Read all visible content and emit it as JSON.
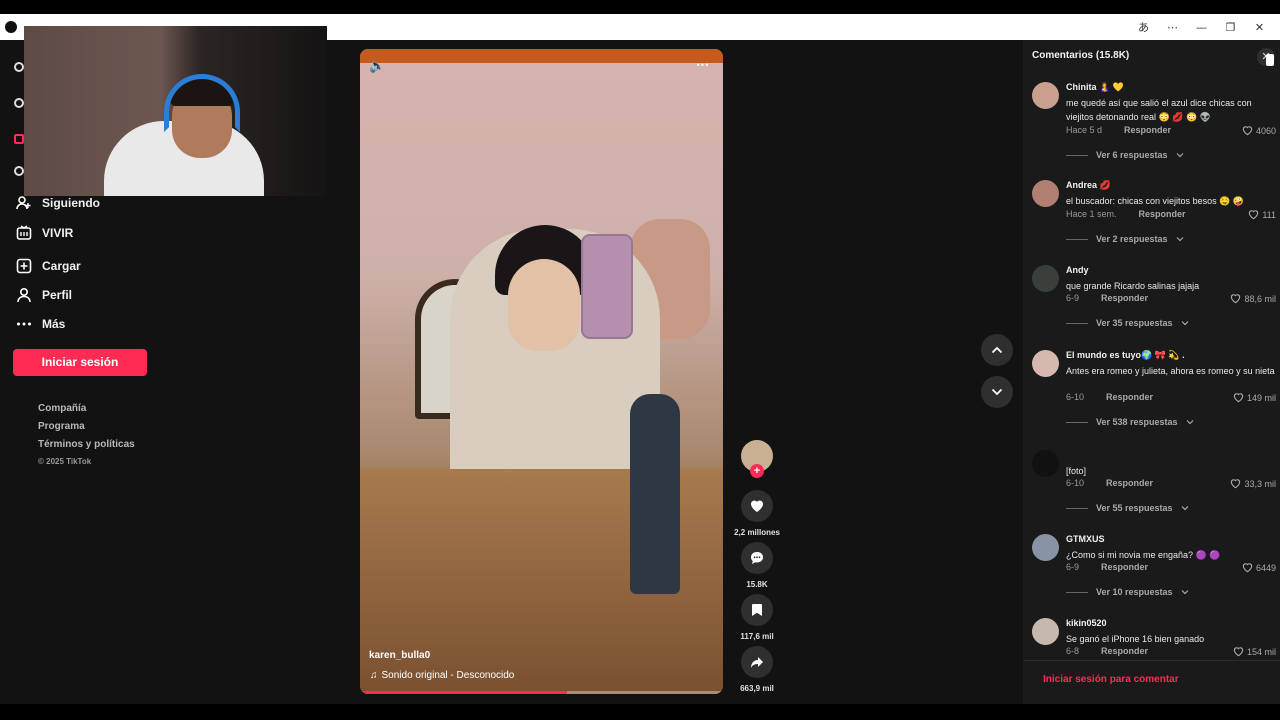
{
  "sidebar": {
    "items": [
      {
        "label": "Siguiendo",
        "icon": "people-icon"
      },
      {
        "label": "VIVIR",
        "icon": "live-icon"
      },
      {
        "label": "Cargar",
        "icon": "upload-icon"
      },
      {
        "label": "Perfil",
        "icon": "person-icon"
      },
      {
        "label": "Más",
        "icon": "more-icon"
      }
    ],
    "login_label": "Iniciar sesión",
    "footer": [
      "Compañía",
      "Programa",
      "Términos y políticas"
    ],
    "copyright": "© 2025 TikTok"
  },
  "video": {
    "username": "karen_bulla0",
    "sound": "Sonido original - Desconocido",
    "progress": 0.57
  },
  "actions": {
    "likes": "2,2 millones",
    "comments": "15.8K",
    "saves": "117,6 mil",
    "shares": "663,9 mil"
  },
  "comments_panel": {
    "title": "Comentarios (15.8K)",
    "footer_prompt": "Iniciar sesión para comentar",
    "reply_label": "Responder",
    "items": [
      {
        "user": "Chinita 🤱 💛",
        "text": "me quedé así que salió el azul dice chicas con viejitos detonando real 😳 💋 😳 👽",
        "time": "Hace 5 d",
        "likes": "4060",
        "more": "Ver 6 respuestas"
      },
      {
        "user": "Andrea 💋",
        "text": "el buscador: chicas con viejitos besos 🤤 🤪",
        "time": "Hace 1 sem.",
        "likes": "111",
        "more": "Ver 2 respuestas"
      },
      {
        "user": "Andy",
        "text": "que grande Ricardo salinas jajaja",
        "time": "6-9",
        "likes": "88,6 mil",
        "more": "Ver 35 respuestas"
      },
      {
        "user": "El mundo es tuyo🌍 🎀 💫 .",
        "text": "Antes era romeo y julieta, ahora es romeo y su nieta",
        "time": "6-10",
        "likes": "149 mil",
        "more": "Ver 538 respuestas"
      },
      {
        "user": "",
        "text": "[foto]",
        "time": "6-10",
        "likes": "33,3 mil",
        "more": "Ver 55 respuestas"
      },
      {
        "user": "GTMXUS",
        "text": "¿Como si mi novia me engaña? 🟣 🟣",
        "time": "6-9",
        "likes": "6449",
        "more": "Ver 10 respuestas"
      },
      {
        "user": "kikin0520",
        "text": "Se ganó el iPhone 16 bien ganado",
        "time": "6-8",
        "likes": "154 mil",
        "more": ""
      }
    ]
  },
  "colors": {
    "accent": "#fe2c55",
    "panel": "#1a1a1a",
    "background": "#121212"
  }
}
